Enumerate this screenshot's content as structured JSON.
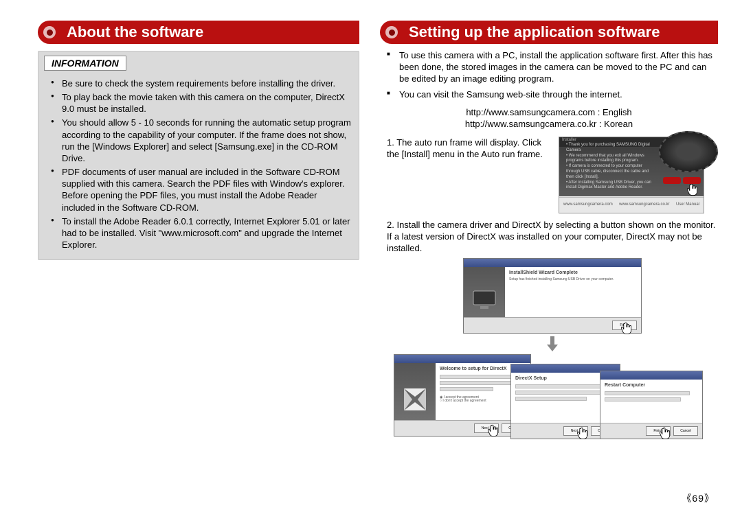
{
  "left": {
    "heading": "About the software",
    "info_label": "INFORMATION",
    "bullets": [
      "Be sure to check the system requirements before installing the driver.",
      "To play back the movie taken with this camera on the computer, DirectX 9.0 must be installed.",
      "You should allow 5 - 10 seconds for running the automatic setup program according to the capability of your computer. If the frame does not show, run the [Windows Explorer] and select [Samsung.exe] in the CD-ROM Drive.",
      "PDF documents of user manual are included in the Software CD-ROM supplied with this camera. Search the PDF files with Window's explorer. Before opening the PDF files, you must install the Adobe Reader included in the Software CD-ROM.",
      "To install the Adobe Reader 6.0.1 correctly, Internet Explorer 5.01 or later had to be installed. Visit \"www.microsoft.com\" and upgrade the Internet Explorer."
    ]
  },
  "right": {
    "heading": "Setting up the application software",
    "sq_bullets": [
      "To use this camera with a PC, install the application software first. After this has been done, the stored images in the camera can be moved to the PC and can be edited by an image editing program.",
      "You can visit the Samsung web-site through the internet."
    ],
    "urls": [
      "http://www.samsungcamera.com : English",
      "http://www.samsungcamera.co.kr : Korean"
    ],
    "step1_num": "1.",
    "step1_text": "The auto run frame will display. Click the [Install] menu in the Auto run frame.",
    "step2_num": "2.",
    "step2_text": "Install the camera driver and DirectX by selecting a button shown on the monitor. If a latest version of DirectX was installed on your computer, DirectX may not be installed.",
    "installer_title": "Installer",
    "installer_footer_left": "www.samsungcamera.com",
    "installer_footer_mid": "www.samsungcamera.co.kr",
    "installer_footer_right": "User Manual",
    "wiz_top": {
      "title": "InstallShield Wizard Complete",
      "text": "Setup has finished installing Samsung USB Driver on your computer.",
      "btn": "Finish"
    },
    "wiz_a": {
      "title": "Welcome to setup for DirectX",
      "btn_next": "Next >",
      "btn_cancel": "Cancel"
    },
    "wiz_b": {
      "title": "DirectX Setup",
      "btn_next": "Next >",
      "btn_cancel": "Cancel"
    },
    "wiz_c": {
      "title": "Restart Computer",
      "btn_ok": "Finish",
      "btn_cancel": "Cancel"
    }
  },
  "page_num": "《69》"
}
